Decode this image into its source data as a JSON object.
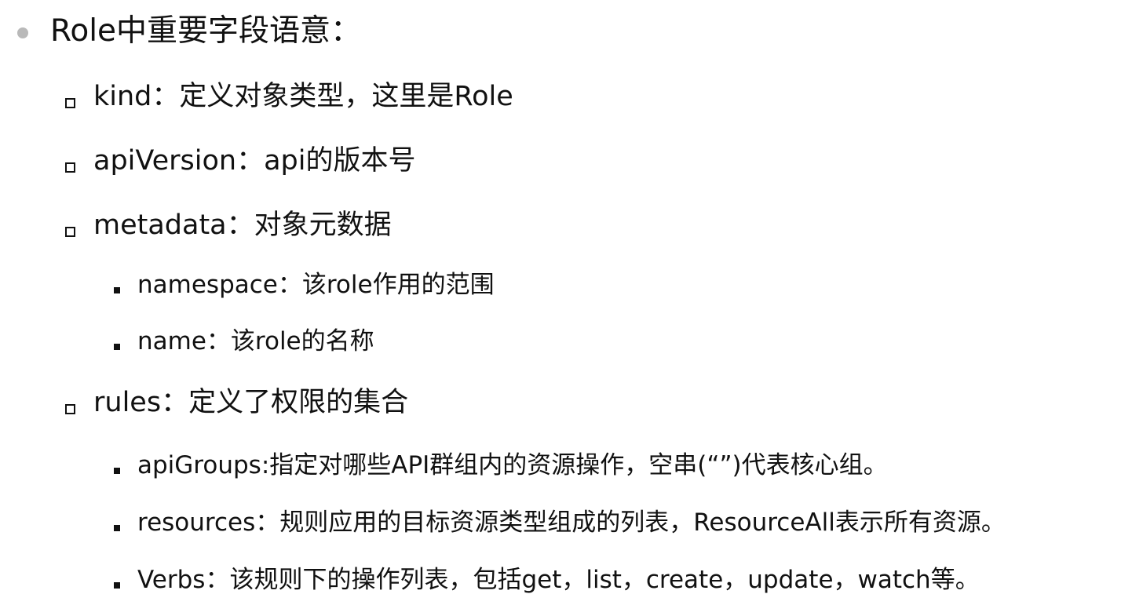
{
  "title": "Role中重要字段语意：",
  "items": [
    {
      "level": 2,
      "text": "kind：定义对象类型，这里是Role"
    },
    {
      "level": 2,
      "text": "apiVersion：api的版本号"
    },
    {
      "level": 2,
      "text": "metadata：对象元数据"
    },
    {
      "level": 3,
      "text": "namespace：该role作用的范围"
    },
    {
      "level": 3,
      "text": "name：该role的名称"
    },
    {
      "level": 2,
      "text": "rules：定义了权限的集合"
    },
    {
      "level": 3,
      "text": "apiGroups:指定对哪些API群组内的资源操作，空串(“”)代表核心组。"
    },
    {
      "level": 3,
      "text": "resources：规则应用的目标资源类型组成的列表，ResourceAll表示所有资源。"
    },
    {
      "level": 3,
      "text": "Verbs：该规则下的操作列表，包括get，list，create，update，watch等。"
    }
  ]
}
